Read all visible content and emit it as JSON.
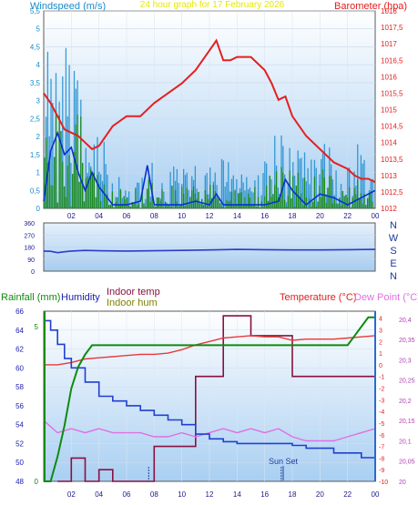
{
  "title": "24 hour graph for  17 February 2026",
  "panels": {
    "wind_baro": {
      "left_axis_label": "Windspeed (m/s)",
      "right_axis_label": "Barometer (hpa)",
      "y_left_ticks": [
        "0",
        "0,5",
        "1",
        "1,5",
        "2",
        "2,5",
        "3",
        "3,5",
        "4",
        "4,5",
        "5",
        "5,5"
      ],
      "y_right_ticks": [
        "1012",
        "1012,5",
        "1013",
        "1013,5",
        "1014",
        "1014,5",
        "1015",
        "1015,5",
        "1016",
        "1016,5",
        "1017",
        "1017,5",
        "1018"
      ],
      "x_ticks": [
        "02",
        "04",
        "06",
        "08",
        "10",
        "12",
        "14",
        "16",
        "18",
        "20",
        "22",
        "00"
      ]
    },
    "wind_dir": {
      "y_ticks": [
        "0",
        "90",
        "180",
        "270",
        "360"
      ],
      "compass": [
        "N",
        "W",
        "S",
        "E",
        "N"
      ]
    },
    "temp_hum": {
      "labels": {
        "rainfall": "Rainfall (mm)",
        "humidity": "Humidity",
        "indoor_temp": "Indoor temp",
        "indoor_hum": "Indoor hum",
        "temperature": "Temperature (°C)",
        "dew_point": "Dew Point (°C)"
      },
      "rain_ticks": [
        "0",
        "5"
      ],
      "humidity_ticks": [
        "48",
        "50",
        "52",
        "54",
        "56",
        "58",
        "60",
        "62",
        "64",
        "66"
      ],
      "temp_ticks": [
        "-10",
        "-9",
        "-8",
        "-7",
        "-6",
        "-5",
        "-4",
        "-3",
        "-2",
        "-1",
        "0",
        "1",
        "2",
        "3",
        "4"
      ],
      "dew_ticks": [
        "20",
        "20,05",
        "20,1",
        "20,15",
        "20,2",
        "20,25",
        "20,3",
        "20,35",
        "20,4"
      ],
      "x_ticks": [
        "02",
        "04",
        "06",
        "08",
        "10",
        "12",
        "14",
        "16",
        "18",
        "20",
        "22",
        "00"
      ],
      "annotation": "Sun Set"
    }
  },
  "colors": {
    "wind": "#1a8ccc",
    "gust": "#0b2fd1",
    "wind_avg": "#1c8a1c",
    "barometer": "#e32020",
    "winddir": "#2a3cc8",
    "rainfall": "#0f8a0f",
    "humidity": "#2040d0",
    "temperature": "#e83a3a",
    "dewpoint": "#e070e0",
    "indoor_temp": "#8a1040",
    "indoor_hum": "#808000",
    "axis_blue": "#1a8cc8",
    "axis_red": "#e02020",
    "axis_dark": "#2020b0"
  },
  "chart_data": [
    {
      "type": "line",
      "title": "24 hour graph for  17 February 2026",
      "ylabel": "Windspeed (m/s)",
      "y2label": "Barometer (hpa)",
      "xlim": [
        0,
        24
      ],
      "ylim": [
        0,
        5.5
      ],
      "y2lim": [
        1012,
        1018
      ],
      "series": [
        {
          "name": "Barometer (hpa)",
          "axis": "right",
          "x": [
            0,
            0.5,
            1,
            1.5,
            2,
            2.5,
            3,
            3.5,
            4,
            5,
            6,
            7,
            8,
            9,
            10,
            11,
            12,
            12.5,
            13,
            13.5,
            14,
            15,
            15.5,
            16,
            16.5,
            17,
            17.5,
            18,
            19,
            20,
            21,
            22,
            22.5,
            23,
            23.5,
            24
          ],
          "values": [
            1015.5,
            1015.2,
            1014.8,
            1014.4,
            1014.3,
            1014.2,
            1014.0,
            1013.8,
            1013.9,
            1014.5,
            1014.8,
            1014.8,
            1015.2,
            1015.5,
            1015.8,
            1016.2,
            1016.8,
            1017.1,
            1016.5,
            1016.5,
            1016.6,
            1016.6,
            1016.4,
            1016.2,
            1015.8,
            1015.3,
            1015.4,
            1014.8,
            1014.2,
            1013.8,
            1013.4,
            1013.2,
            1013.0,
            1012.9,
            1012.9,
            1012.8
          ]
        },
        {
          "name": "gust",
          "axis": "left",
          "x": [
            0,
            0.5,
            1,
            1.5,
            2,
            2.5,
            3,
            3.5,
            4,
            5,
            6,
            7,
            7.5,
            8,
            9,
            10,
            11,
            12,
            12.5,
            13,
            14,
            15,
            16,
            17,
            17.5,
            18,
            19,
            20,
            21,
            22,
            23,
            24
          ],
          "values": [
            0.2,
            1.6,
            2.1,
            1.5,
            1.7,
            1.0,
            0.5,
            1.0,
            0.6,
            0.1,
            0.1,
            0.2,
            1.2,
            0.1,
            0.1,
            0.1,
            0.2,
            0.1,
            0.4,
            0.1,
            0.1,
            0.1,
            0.1,
            0.2,
            0.8,
            0.5,
            0.1,
            0.4,
            0.3,
            0.1,
            0.3,
            0.5
          ]
        }
      ]
    },
    {
      "type": "line",
      "ylabel": "",
      "xlim": [
        0,
        24
      ],
      "ylim": [
        0,
        360
      ],
      "series": [
        {
          "name": "wind direction",
          "x": [
            0,
            0.5,
            1,
            1.5,
            2,
            3,
            4,
            6,
            8,
            10,
            12,
            14,
            16,
            18,
            20,
            22,
            24
          ],
          "values": [
            150,
            148,
            138,
            145,
            150,
            155,
            152,
            150,
            152,
            155,
            158,
            162,
            160,
            158,
            158,
            160,
            162
          ]
        }
      ]
    },
    {
      "type": "line",
      "xlim": [
        0,
        24
      ],
      "series": [
        {
          "name": "Rainfall (mm)",
          "axis": "rain",
          "x": [
            0,
            0.5,
            1,
            1.5,
            2,
            2.5,
            3,
            3.5,
            4,
            5,
            6,
            8,
            10,
            12,
            14,
            16,
            18,
            20,
            22,
            22.5,
            23,
            23.5,
            24
          ],
          "values": [
            0,
            0,
            0.8,
            1.8,
            3.0,
            3.7,
            4.1,
            4.4,
            4.4,
            4.4,
            4.4,
            4.4,
            4.4,
            4.4,
            4.4,
            4.4,
            4.4,
            4.4,
            4.4,
            4.7,
            5.0,
            5.3,
            5.3
          ]
        },
        {
          "name": "Humidity",
          "axis": "humidity",
          "x": [
            0,
            0.5,
            1,
            1.5,
            2,
            3,
            4,
            5,
            6,
            7,
            8,
            9,
            10,
            11,
            12,
            13,
            14,
            15,
            16,
            17,
            18,
            19,
            20,
            21,
            22,
            23,
            24
          ],
          "values": [
            65,
            64,
            62.5,
            61,
            60,
            58.5,
            57,
            56.5,
            56,
            55.5,
            55,
            54.5,
            54,
            53,
            52.5,
            52.2,
            52,
            52,
            52,
            52,
            51.8,
            51.5,
            51.5,
            51,
            51,
            50.5,
            50
          ]
        },
        {
          "name": "Temperature (°C)",
          "axis": "temp",
          "x": [
            0,
            1,
            2,
            3,
            4,
            5,
            6,
            7,
            8,
            9,
            10,
            11,
            12,
            13,
            14,
            15,
            16,
            17,
            18,
            19,
            20,
            21,
            22,
            23,
            24
          ],
          "values": [
            0,
            0,
            0.2,
            0.5,
            0.6,
            0.7,
            0.8,
            0.9,
            0.9,
            1.0,
            1.3,
            1.7,
            2.0,
            2.3,
            2.4,
            2.5,
            2.4,
            2.4,
            2.1,
            2.2,
            2.2,
            2.2,
            2.3,
            2.4,
            2.5
          ]
        },
        {
          "name": "Dew Point (°C)",
          "axis": "dew",
          "x": [
            0,
            1,
            2,
            3,
            4,
            5,
            6,
            7,
            8,
            9,
            10,
            11,
            12,
            13,
            14,
            15,
            16,
            17,
            18,
            19,
            20,
            21,
            22,
            23,
            24
          ],
          "values": [
            20.15,
            20.12,
            20.13,
            20.12,
            20.13,
            20.12,
            20.12,
            20.12,
            20.11,
            20.11,
            20.12,
            20.11,
            20.12,
            20.13,
            20.12,
            20.13,
            20.12,
            20.13,
            20.11,
            20.1,
            20.1,
            20.1,
            20.11,
            20.12,
            20.13
          ]
        }
      ]
    }
  ]
}
